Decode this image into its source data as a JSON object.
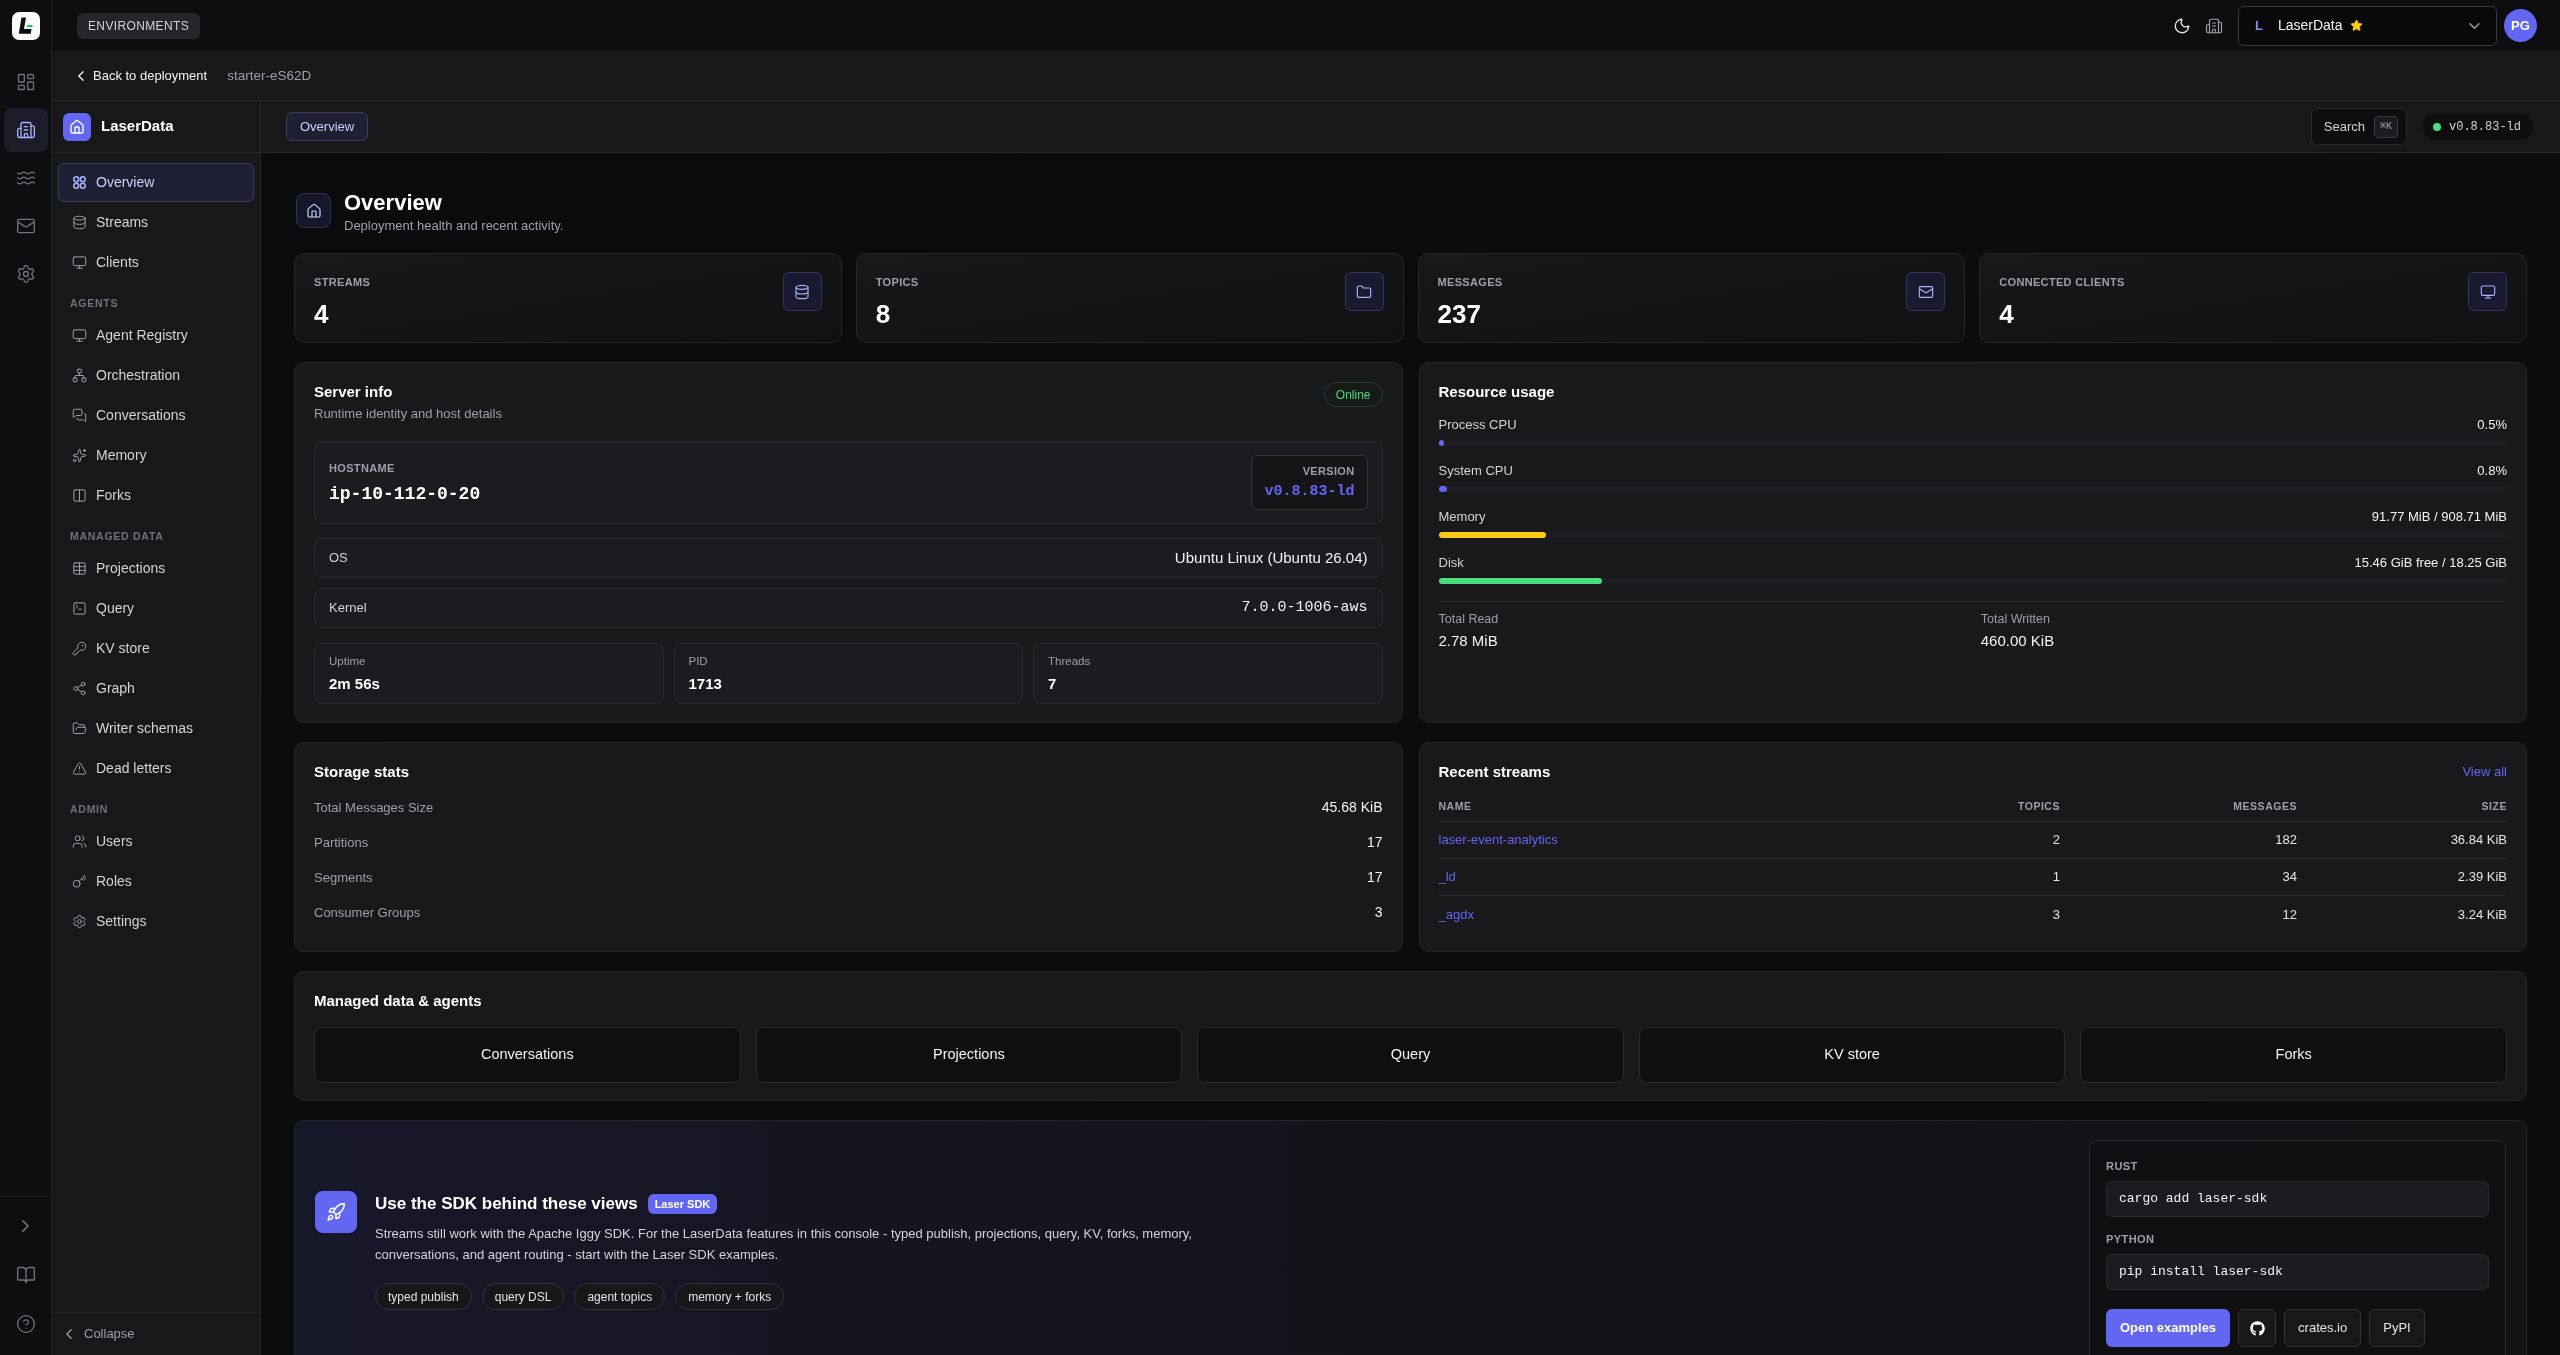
{
  "top_bar": {
    "environments": "ENVIRONMENTS",
    "org_selector": {
      "initial": "L",
      "name": "LaserData",
      "starred": true
    },
    "avatar": "PG"
  },
  "rail": {
    "items": [
      {
        "selected": false
      },
      {
        "selected": true
      },
      {
        "selected": false
      },
      {
        "selected": false
      },
      {
        "selected": false
      }
    ]
  },
  "breadcrumb": {
    "back": "Back to deployment",
    "deployment": "starter-eS62D"
  },
  "sidebar": {
    "title": "LaserData",
    "sections": [
      {
        "items": [
          {
            "label": "Overview",
            "selected": true
          },
          {
            "label": "Streams",
            "selected": false
          },
          {
            "label": "Clients",
            "selected": false
          }
        ]
      },
      {
        "heading": "AGENTS",
        "items": [
          {
            "label": "Agent Registry",
            "selected": false
          },
          {
            "label": "Orchestration",
            "selected": false
          },
          {
            "label": "Conversations",
            "selected": false
          },
          {
            "label": "Memory",
            "selected": false
          },
          {
            "label": "Forks",
            "selected": false
          }
        ]
      },
      {
        "heading": "MANAGED DATA",
        "items": [
          {
            "label": "Projections",
            "selected": false
          },
          {
            "label": "Query",
            "selected": false
          },
          {
            "label": "KV store",
            "selected": false
          },
          {
            "label": "Graph",
            "selected": false
          },
          {
            "label": "Writer schemas",
            "selected": false
          },
          {
            "label": "Dead letters",
            "selected": false
          }
        ]
      },
      {
        "heading": "ADMIN",
        "items": [
          {
            "label": "Users",
            "selected": false
          },
          {
            "label": "Roles",
            "selected": false
          },
          {
            "label": "Settings",
            "selected": false
          }
        ]
      }
    ],
    "collapse": "Collapse"
  },
  "header": {
    "tabs": [
      {
        "label": "Overview",
        "selected": true
      }
    ],
    "search": {
      "label": "Search",
      "shortcut": "⌘K"
    },
    "version": "v0.8.83-ld"
  },
  "page": {
    "title": "Overview",
    "subtitle": "Deployment health and recent activity."
  },
  "stats": [
    {
      "label": "STREAMS",
      "value": "4"
    },
    {
      "label": "TOPICS",
      "value": "8"
    },
    {
      "label": "MESSAGES",
      "value": "237"
    },
    {
      "label": "CONNECTED CLIENTS",
      "value": "4"
    }
  ],
  "server_info": {
    "title": "Server info",
    "subtitle": "Runtime identity and host details",
    "status": "Online",
    "hostname": {
      "label": "HOSTNAME",
      "value": "ip-10-112-0-20"
    },
    "version": {
      "label": "VERSION",
      "value": "v0.8.83-ld"
    },
    "rows": [
      {
        "label": "OS",
        "value": "Ubuntu Linux (Ubuntu 26.04)",
        "kind": "text"
      },
      {
        "label": "Kernel",
        "value": "7.0.0-1006-aws",
        "kind": "code"
      }
    ],
    "metrics": [
      {
        "label": "Uptime",
        "value": "2m 56s"
      },
      {
        "label": "PID",
        "value": "1713"
      },
      {
        "label": "Threads",
        "value": "7"
      }
    ]
  },
  "resource_usage": {
    "title": "Resource usage",
    "meters": [
      {
        "label": "Process CPU",
        "reading": "0.5%",
        "level": 0.005,
        "color": "#6366f1"
      },
      {
        "label": "System CPU",
        "reading": "0.8%",
        "level": 0.008,
        "color": "#6366f1"
      },
      {
        "label": "Memory",
        "reading": "91.77 MiB / 908.71 MiB",
        "level": 0.101,
        "color": "#facc15"
      },
      {
        "label": "Disk",
        "reading": "15.46 GiB free / 18.25 GiB",
        "level": 0.153,
        "color": "#4ade80"
      }
    ],
    "totals": [
      {
        "label": "Total Read",
        "value": "2.78 MiB"
      },
      {
        "label": "Total Written",
        "value": "460.00 KiB"
      }
    ]
  },
  "storage_stats": {
    "title": "Storage stats",
    "rows": [
      {
        "label": "Total Messages Size",
        "value": "45.68 KiB"
      },
      {
        "label": "Partitions",
        "value": "17"
      },
      {
        "label": "Segments",
        "value": "17"
      },
      {
        "label": "Consumer Groups",
        "value": "3"
      }
    ]
  },
  "recent_streams": {
    "title": "Recent streams",
    "view_all": "View all",
    "columns": [
      "NAME",
      "TOPICS",
      "MESSAGES",
      "SIZE"
    ],
    "rows": [
      {
        "name": "laser-event-analytics",
        "topics": "2",
        "messages": "182",
        "size": "36.84 KiB"
      },
      {
        "name": "_ld",
        "topics": "1",
        "messages": "34",
        "size": "2.39 KiB"
      },
      {
        "name": "_agdx",
        "topics": "3",
        "messages": "12",
        "size": "3.24 KiB"
      }
    ]
  },
  "managed_data": {
    "title": "Managed data & agents",
    "links": [
      "Conversations",
      "Projections",
      "Query",
      "KV store",
      "Forks"
    ]
  },
  "sdk": {
    "title": "Use the SDK behind these views",
    "badge": "Laser SDK",
    "description": "Streams still work with the Apache Iggy SDK. For the LaserData features in this console - typed publish, projections, query, KV, forks, memory, conversations, and agent routing - start with the Laser SDK examples.",
    "tags": [
      "typed publish",
      "query DSL",
      "agent topics",
      "memory + forks"
    ],
    "install": [
      {
        "label": "RUST",
        "command": "cargo add laser-sdk"
      },
      {
        "label": "PYTHON",
        "command": "pip install laser-sdk"
      }
    ],
    "buttons": [
      {
        "kind": "primary",
        "label": "Open examples"
      },
      {
        "kind": "github"
      },
      {
        "kind": "outline",
        "label": "crates.io"
      },
      {
        "kind": "outline",
        "label": "PyPI"
      }
    ]
  }
}
